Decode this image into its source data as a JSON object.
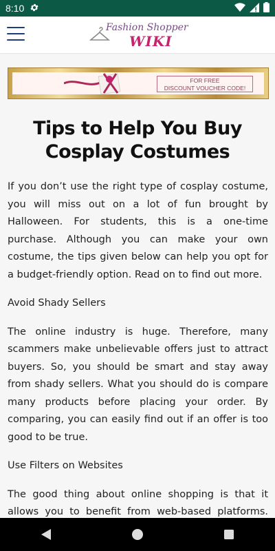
{
  "status_bar": {
    "time": "8:10"
  },
  "header": {
    "logo_line1": "Fashion Shopper",
    "logo_line2": "WIKI"
  },
  "banner": {
    "voucher_line1": "FOR FREE",
    "voucher_line2": "DISCOUNT VOUCHER CODE!"
  },
  "article": {
    "title": "Tips to Help You Buy Cosplay Costumes",
    "paragraphs": [
      "If you don’t use the right type of cosplay costume, you will miss out on a lot of fun brought by Halloween. For students, this is a one-time purchase. Although you can make your own costume, the tips given below can help you opt for a budget-friendly option. Read on to find out more.",
      "Avoid Shady Sellers",
      "The online industry is huge. Therefore, many scammers make unbelievable offers just to attract buyers. So, you should be smart and stay away from shady sellers. What you should do is compare many products before placing your order. By comparing, you can easily find out if an offer is too good to be true.",
      "Use Filters on Websites",
      "The good thing about online shopping is that it allows you to benefit from web-based platforms. With this service, you can save a lot of time as you won’t need to walk"
    ]
  },
  "colors": {
    "status_bar": "#0c5a46",
    "menu_icon": "#1f3b7a",
    "logo_purple": "#7a4a8a",
    "logo_pink": "#c4246e"
  }
}
